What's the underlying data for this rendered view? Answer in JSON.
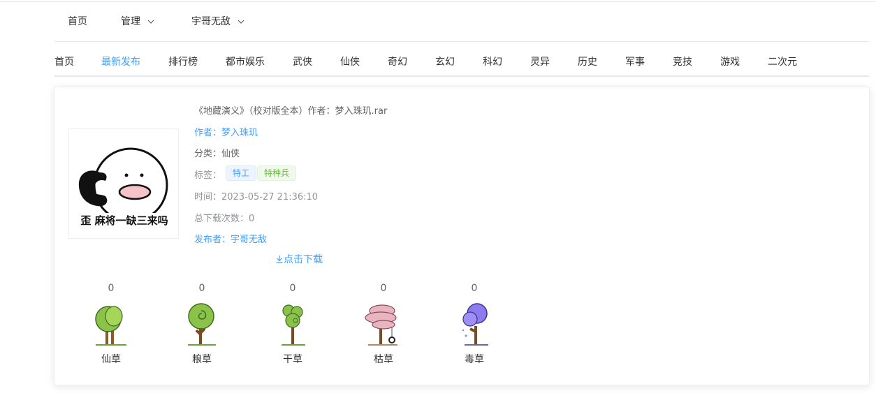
{
  "top_menu": {
    "home": "首页",
    "manage": "管理",
    "user": "宇哥无敌"
  },
  "categories": [
    {
      "label": "首页",
      "active": false
    },
    {
      "label": "最新发布",
      "active": true
    },
    {
      "label": "排行榜",
      "active": false
    },
    {
      "label": "都市娱乐",
      "active": false
    },
    {
      "label": "武侠",
      "active": false
    },
    {
      "label": "仙侠",
      "active": false
    },
    {
      "label": "奇幻",
      "active": false
    },
    {
      "label": "玄幻",
      "active": false
    },
    {
      "label": "科幻",
      "active": false
    },
    {
      "label": "灵异",
      "active": false
    },
    {
      "label": "历史",
      "active": false
    },
    {
      "label": "军事",
      "active": false
    },
    {
      "label": "竞技",
      "active": false
    },
    {
      "label": "游戏",
      "active": false
    },
    {
      "label": "二次元",
      "active": false
    }
  ],
  "book": {
    "cover_caption": "歪 麻将一缺三来吗",
    "title": "《地藏演义》（校对版全本）作者：梦入珠玑.rar",
    "author": "作者：梦入珠玑",
    "category": "分类：仙侠",
    "tags_label": "标签：",
    "tags": [
      "特工",
      "特种兵"
    ],
    "time": "时间：2023-05-27 21:36:10",
    "downloads": "总下载次数：0",
    "publisher": "发布者：宇哥无敌",
    "download_label": "点击下载"
  },
  "votes": [
    {
      "count": "0",
      "label": "仙草",
      "icon": "green-tree-icon"
    },
    {
      "count": "0",
      "label": "粮草",
      "icon": "swirl-tree-icon"
    },
    {
      "count": "0",
      "label": "干草",
      "icon": "dry-tree-icon"
    },
    {
      "count": "0",
      "label": "枯草",
      "icon": "pink-swing-tree-icon"
    },
    {
      "count": "0",
      "label": "毒草",
      "icon": "purple-tree-icon"
    }
  ],
  "colors": {
    "accent": "#409eff",
    "text": "#303133",
    "muted": "#909399",
    "tag_green": "#67c23a"
  }
}
